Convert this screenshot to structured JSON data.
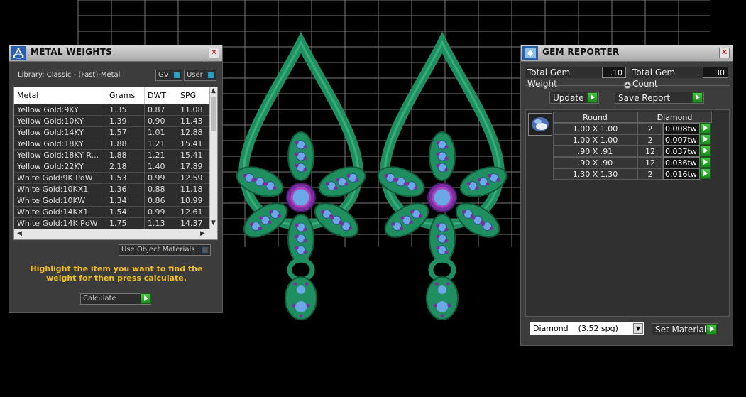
{
  "metal_panel": {
    "title": "METAL WEIGHTS",
    "library": "Library: Classic - (Fast)-Metal",
    "gv_label": "GV",
    "user_label": "User",
    "columns": [
      "Metal",
      "Grams",
      "DWT",
      "SPG"
    ],
    "rows": [
      [
        "Yellow Gold:9KY",
        "1.35",
        "0.87",
        "11.08"
      ],
      [
        "Yellow Gold:10KY",
        "1.39",
        "0.90",
        "11.43"
      ],
      [
        "Yellow Gold:14KY",
        "1.57",
        "1.01",
        "12.88"
      ],
      [
        "Yellow Gold:18KY",
        "1.88",
        "1.21",
        "15.41"
      ],
      [
        "Yellow Gold:18KY R...",
        "1.88",
        "1.21",
        "15.41"
      ],
      [
        "Yellow Gold:22KY",
        "2.18",
        "1.40",
        "17.89"
      ],
      [
        "White Gold:9K PdW",
        "1.53",
        "0.99",
        "12.59"
      ],
      [
        "White Gold:10KX1",
        "1.36",
        "0.88",
        "11.18"
      ],
      [
        "White Gold:10KW",
        "1.34",
        "0.86",
        "10.99"
      ],
      [
        "White Gold:14KX1",
        "1.54",
        "0.99",
        "12.61"
      ],
      [
        "White Gold:14K PdW",
        "1.75",
        "1.13",
        "14.37"
      ]
    ],
    "use_object_materials": "Use Object Materials",
    "hint": "Highlight the item you want to find the weight for then press calculate.",
    "calculate_label": "Calculate"
  },
  "gem_panel": {
    "title": "GEM REPORTER",
    "total_weight_label": "Total Gem Weight",
    "total_weight_value": ".10",
    "total_count_label": "Total Gem Count",
    "total_count_value": "30",
    "update_label": "Update",
    "save_report_label": "Save Report",
    "headers": [
      "Round",
      "Diamond"
    ],
    "rows": [
      {
        "size": "1.00 X 1.00",
        "count": "2",
        "weight": "0.008tw"
      },
      {
        "size": "1.00 X 1.00",
        "count": "2",
        "weight": "0.007tw"
      },
      {
        "size": ".90 X .91",
        "count": "12",
        "weight": "0.037tw"
      },
      {
        "size": ".90 X .90",
        "count": "12",
        "weight": "0.036tw"
      },
      {
        "size": "1.30 X 1.30",
        "count": "2",
        "weight": "0.016tw"
      }
    ],
    "material_select": "Diamond    (3.52 spg)",
    "set_material_label": "Set Material"
  },
  "colors": {
    "metal": "#1f8f5f",
    "metal_light": "#35b07a",
    "gem": "#6aa8e8",
    "prong": "#7a2ea0",
    "center": "#b040c0",
    "grid": "#777777"
  }
}
